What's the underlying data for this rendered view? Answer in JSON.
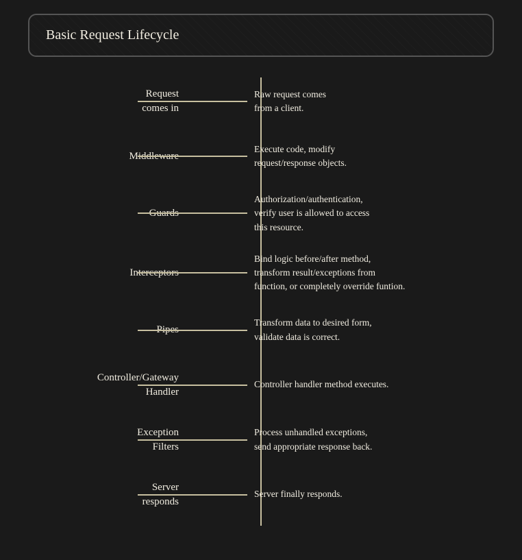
{
  "title": "Basic Request Lifecycle",
  "items": [
    {
      "label": "Request\ncomes in",
      "description": "Raw request comes\nfrom a client."
    },
    {
      "label": "Middleware",
      "description": "Execute code, modify\nrequest/response objects."
    },
    {
      "label": "Guards",
      "description": "Authorization/authentication,\nverify user is allowed to access\nthis resource."
    },
    {
      "label": "Interceptors",
      "description": "Bind logic before/after method,\ntransform result/exceptions from\nfunction, or completely override funtion."
    },
    {
      "label": "Pipes",
      "description": "Transform data to desired form,\nvalidate data is correct."
    },
    {
      "label": "Controller/Gateway\nHandler",
      "description": "Controller handler method executes."
    },
    {
      "label": "Exception\nFilters",
      "description": "Process unhandled exceptions,\nsend appropriate response back."
    },
    {
      "label": "Server\nresponds",
      "description": "Server finally responds."
    }
  ]
}
